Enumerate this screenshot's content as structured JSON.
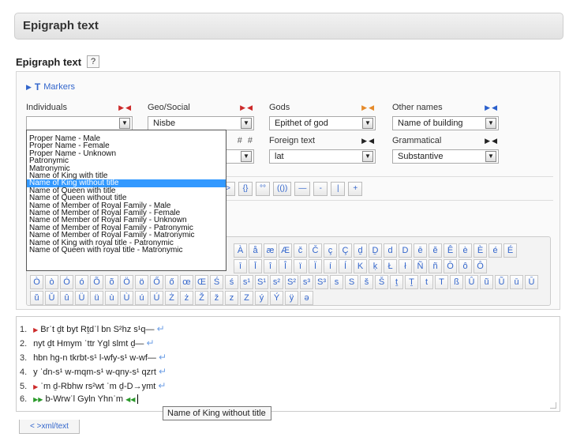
{
  "header": {
    "title": "Epigraph text"
  },
  "section": {
    "title": "Epigraph text",
    "help": "?"
  },
  "markers": {
    "icon_letter": "T",
    "label": "Markers"
  },
  "selectors": [
    {
      "label": "Individuals",
      "value": "",
      "arrow_color": "#cc2a2a"
    },
    {
      "label": "Geo/Social",
      "value": "Nisbe",
      "arrow_color": "#cc2a2a"
    },
    {
      "label": "Gods",
      "value": "Epithet of god",
      "arrow_color": "#e58a2a"
    },
    {
      "label": "Other names",
      "value": "Name of building",
      "arrow_color": "#2a5fcc"
    },
    {
      "label": "",
      "value": "",
      "hash": "# #"
    },
    {
      "label": "Foreign text",
      "value": "lat",
      "arrow_color": "#222222"
    },
    {
      "label": "Grammatical",
      "value": "Substantive",
      "arrow_color": "#222222"
    }
  ],
  "dropdown": {
    "options": [
      "Proper Name - Male",
      "Proper Name - Female",
      "Proper Name - Unknown",
      "Patronymic",
      "Matronymic",
      "Name of King with title",
      "Name of King without title",
      "Name of Queen with title",
      "Name of Queen without title",
      "Name of Member of Royal Family - Male",
      "Name of Member of Royal Family - Female",
      "Name of Member of Royal Family - Unknown",
      "Name of Member of Royal Family - Patronymic",
      "Name of Member of Royal Family - Matronymic",
      "Name of King with royal title - Patronymic",
      "Name of Queen with royal title - Matronymic"
    ],
    "selected_index": 6
  },
  "toolbar": {
    "buttons": [
      ">",
      "{}",
      "°°",
      "(())",
      "—",
      "-",
      "|",
      "+"
    ]
  },
  "charpad": {
    "rows": [
      [
        "À",
        "å",
        "æ",
        "Æ",
        "č",
        "Č",
        "ç",
        "Ç",
        "ḏ",
        "Ḏ",
        "d",
        "D",
        "ē",
        "ĕ",
        "Ê",
        "è",
        "È",
        "é",
        "É"
      ],
      [
        "ī",
        "Ī",
        "î",
        "Î",
        "ï",
        "Ï",
        "í",
        "Í",
        "K",
        "ḳ",
        "Ł",
        "ł",
        "Ñ",
        "ñ",
        "Ō",
        "ô",
        "Ô"
      ],
      [
        "Ò",
        "ò",
        "Ó",
        "ó",
        "Õ",
        "õ",
        "Ö",
        "ö",
        "Ő",
        "ő",
        "œ",
        "Œ",
        "Ś",
        "ś",
        "s¹",
        "S¹",
        "s²",
        "S²",
        "s³",
        "S³",
        "s",
        "S",
        "š",
        "Š",
        "ṯ",
        "Ṯ",
        "t",
        "T",
        "ß",
        "Û",
        "ũ",
        "Ũ",
        "ū",
        "Ū"
      ],
      [
        "ŭ",
        "Ŭ",
        "û",
        "Ü",
        "ü",
        "ù",
        "Ù",
        "ú",
        "Ú",
        "Ż",
        "ż",
        "Ž",
        "ž",
        "z",
        "Z",
        "ý",
        "Ý",
        "ÿ",
        "ə"
      ]
    ]
  },
  "editor": {
    "lines": [
      {
        "num": "1.",
        "text": "Brʿt ḏt byt Rṯdʿl bn S²hz s¹q—"
      },
      {
        "num": "2.",
        "text": "nyt ḏt Hmym ʿttr Ygl slmt ḏ—"
      },
      {
        "num": "3.",
        "text": "hbn hg-n tkrbt-s¹ l-wfy-s¹ w-wf—"
      },
      {
        "num": "4.",
        "text": "y ʿdn-s¹ w-mqm-s¹ w-qny-s¹ qzrt"
      },
      {
        "num": "5.",
        "text": "ʿm ḏ-Rbhw rs²wt ʿm ḏ-D→ymt"
      },
      {
        "num": "6.",
        "text": "b-Wrwʿl Gyln Yhnʿm"
      }
    ]
  },
  "tooltip": {
    "text": "Name of King without title"
  },
  "xml_toggle": {
    "label": "< >xml/text"
  }
}
